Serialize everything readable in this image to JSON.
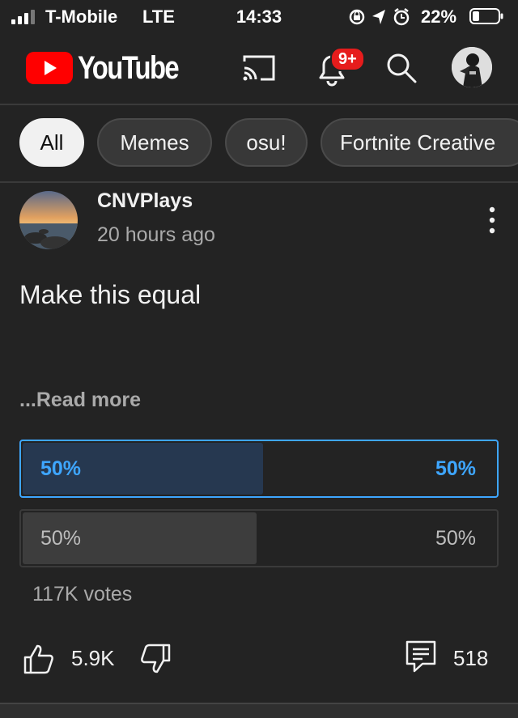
{
  "status_bar": {
    "carrier": "T-Mobile",
    "network": "LTE",
    "time": "14:33",
    "battery_percent": "22%",
    "icons": [
      "signal-icon",
      "rotation-lock-icon",
      "location-icon",
      "alarm-icon",
      "battery-icon"
    ]
  },
  "header": {
    "logo_text": "YouTube",
    "notification_badge": "9+",
    "icons": [
      "cast-icon",
      "bell-icon",
      "search-icon",
      "avatar"
    ]
  },
  "chips": [
    {
      "label": "All",
      "active": true
    },
    {
      "label": "Memes",
      "active": false
    },
    {
      "label": "osu!",
      "active": false
    },
    {
      "label": "Fortnite Creative",
      "active": false
    }
  ],
  "post": {
    "channel_name": "CNVPlays",
    "time_ago": "20 hours ago",
    "text": "Make this equal",
    "read_more": "...Read more",
    "poll": {
      "options": [
        {
          "left_label": "50%",
          "right_label": "50%",
          "share": 0.5,
          "selected": true
        },
        {
          "left_label": "50%",
          "right_label": "50%",
          "share": 0.5,
          "selected": false
        }
      ],
      "votes": "117K votes"
    },
    "likes": "5.9K",
    "comments": "518"
  },
  "colors": {
    "background": "#232323",
    "accent_blue": "#3ea6ff",
    "youtube_red": "#ff0000",
    "badge_red": "#e61c1c"
  }
}
